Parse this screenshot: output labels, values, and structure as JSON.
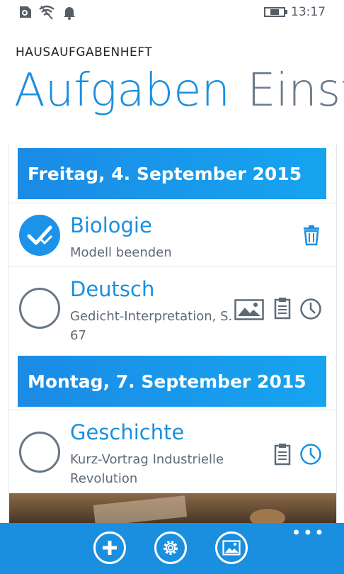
{
  "status_bar": {
    "time": "13:17"
  },
  "header": {
    "app_title": "HAUSAUFGABENHEFT",
    "pivot_active": "Aufgaben",
    "pivot_next": "Einst"
  },
  "days": [
    {
      "header": "Freitag, 4. September 2015",
      "tasks": [
        {
          "subject": "Biologie",
          "description": "Modell beenden",
          "done": true
        },
        {
          "subject": "Deutsch",
          "description": "Gedicht-Interpretation, S. 67",
          "done": false
        }
      ]
    },
    {
      "header": "Montag, 7. September 2015",
      "tasks": [
        {
          "subject": "Geschichte",
          "description": "Kurz-Vortrag Industrielle Revolution",
          "done": false
        }
      ]
    }
  ],
  "app_bar": {
    "buttons": [
      "add-icon",
      "settings-icon",
      "image-icon"
    ],
    "more": "•••"
  },
  "colors": {
    "accent": "#1a8fe0",
    "text_secondary": "#5e6a78"
  }
}
